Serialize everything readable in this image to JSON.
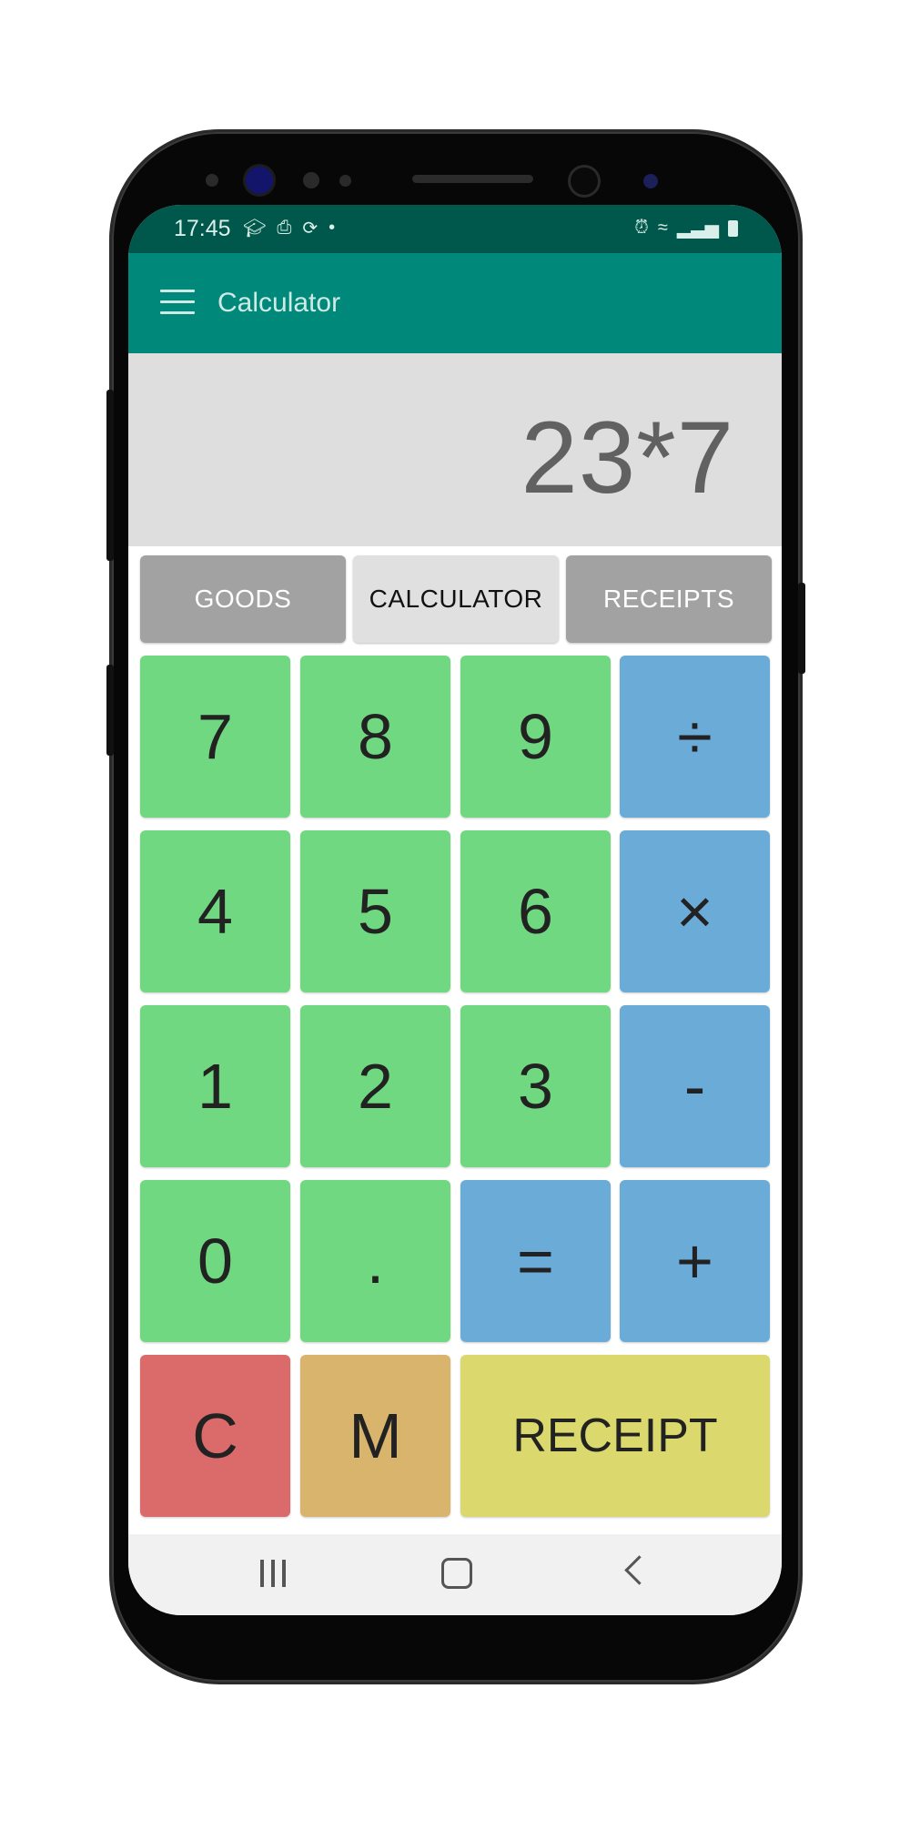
{
  "status_bar": {
    "time": "17:45",
    "left_icons": [
      "graduation-cap-icon",
      "print-icon",
      "sync-icon",
      "dot-icon"
    ],
    "right_icons": [
      "alarm-icon",
      "wifi-icon",
      "signal-icon",
      "battery-icon"
    ]
  },
  "app_bar": {
    "title": "Calculator",
    "menu_icon": "hamburger-menu-icon",
    "color": "#00897b"
  },
  "display": {
    "expression": "23*7"
  },
  "tabs": [
    {
      "label": "GOODS",
      "active": false
    },
    {
      "label": "CALCULATOR",
      "active": true
    },
    {
      "label": "RECEIPTS",
      "active": false
    }
  ],
  "keypad": {
    "row1": [
      "7",
      "8",
      "9",
      "÷"
    ],
    "row2": [
      "4",
      "5",
      "6",
      "×"
    ],
    "row3": [
      "1",
      "2",
      "3",
      "-"
    ],
    "row4": [
      "0",
      ".",
      "=",
      "+"
    ],
    "row5": [
      "C",
      "M",
      "RECEIPT"
    ]
  },
  "colors": {
    "digit": "#6fd880",
    "operator": "#6babd8",
    "clear": "#db6b6b",
    "memory": "#d9b46c",
    "receipt": "#dbd96d"
  },
  "nav_bar": {
    "icons": [
      "recent-apps-icon",
      "home-icon",
      "back-icon"
    ]
  }
}
